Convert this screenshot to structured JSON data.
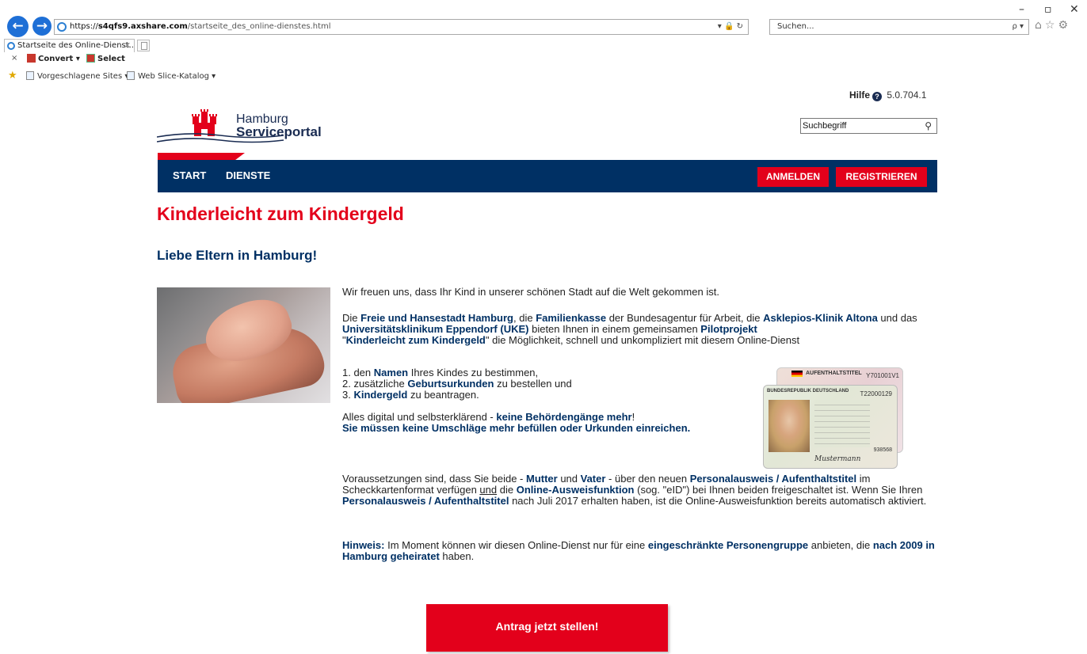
{
  "browser": {
    "back_icon": "arrow-left-icon",
    "forward_icon": "arrow-right-icon",
    "url_prefix": "https://",
    "url_host": "s4qfs9.axshare.com",
    "url_path": "/startseite_des_online-dienstes.html",
    "address_tools": "▾ 🔒 ↻",
    "search_placeholder": "Suchen...",
    "search_tools": "ρ ▾",
    "tab_title": "Startseite des Online-Dienst...",
    "tab_close": "×",
    "toolbar_close": "×",
    "convert_label": "Convert ▾",
    "select_label": "Select",
    "fav_suggested": "Vorgeschlagene Sites ▾",
    "fav_webslice": "Web Slice-Katalog ▾",
    "win_min": "–",
    "win_max": "▫",
    "win_close": "✕",
    "right_icons": "⌂☆⚙"
  },
  "header": {
    "help_label": "Hilfe",
    "version": "5.0.704.1",
    "logo_line1": "Hamburg",
    "logo_line2": "Serviceportal",
    "search_value": "Suchbegriff"
  },
  "nav": {
    "start": "START",
    "dienste": "DIENSTE",
    "anmelden": "ANMELDEN",
    "registrieren": "REGISTRIEREN"
  },
  "main": {
    "title": "Kinderleicht zum Kindergeld",
    "subtitle": "Liebe Eltern in Hamburg!",
    "intro": "Wir freuen uns, dass Ihr Kind in unserer schönen Stadt auf die Welt gekommen ist.",
    "p2_a": "Die ",
    "p2_b": "Freie und Hansestadt Hamburg",
    "p2_c": ", die ",
    "p2_d": "Familienkasse",
    "p2_e": " der Bundesagentur für Arbeit, die ",
    "p2_f": "Asklepios-Klinik Altona",
    "p2_g": " und das ",
    "p2_h": "Universitätsklinikum Eppendorf (UKE)",
    "p2_i": " bieten Ihnen in einem gemeinsamen ",
    "p2_j": "Pilotprojekt",
    "p2_k": "\"",
    "p2_l": "Kinderleicht zum Kindergeld",
    "p2_m": "\" die Möglichkeit, schnell und unkompliziert mit diesem Online-Dienst",
    "list1_a": "1. den ",
    "list1_b": "Namen",
    "list1_c": " Ihres Kindes zu bestimmen,",
    "list2_a": "2. zusätzliche ",
    "list2_b": "Geburtsurkunden",
    "list2_c": " zu bestellen und",
    "list3_a": "3. ",
    "list3_b": "Kindergeld",
    "list3_c": " zu beantragen.",
    "digital_a": "Alles digital und selbsterklärend - ",
    "digital_b": "keine Behördengänge mehr",
    "digital_c": "!",
    "digital_line2": "Sie müssen keine Umschläge mehr befüllen oder Urkunden einreichen.",
    "req_a": "Voraussetzungen sind, dass Sie beide - ",
    "req_b": "Mutter",
    "req_c": " und ",
    "req_d": "Vater",
    "req_e": " - über den neuen ",
    "req_f": "Personalausweis / Aufenthaltstitel",
    "req_g": " im Scheckkartenformat verfügen ",
    "req_h": "und",
    "req_i": " die ",
    "req_j": "Online-Ausweisfunktion",
    "req_k": " (sog. \"eID\") bei Ihnen beiden freigeschaltet ist. Wenn Sie Ihren ",
    "req_l": "Personalausweis / Aufenthaltstitel",
    "req_m": " nach Juli 2017 erhalten haben, ist die Online-Ausweisfunktion bereits automatisch aktiviert.",
    "hint_a": "Hinweis:",
    "hint_b": " Im Moment können wir diesen Online-Dienst nur für eine ",
    "hint_c": "eingeschränkte Personengruppe",
    "hint_d": " anbieten, die ",
    "hint_e": "nach 2009 in Hamburg geheiratet",
    "hint_f": " haben.",
    "cta": "Antrag jetzt stellen!"
  },
  "idcard": {
    "back_title": "AUFENTHALTSTITEL",
    "back_number": "Y701001V1",
    "front_title": "BUNDESREPUBLIK DEUTSCHLAND",
    "front_number": "T22000129",
    "front_can": "938568"
  },
  "colors": {
    "brand_red": "#e3001b",
    "brand_navy": "#003064"
  }
}
